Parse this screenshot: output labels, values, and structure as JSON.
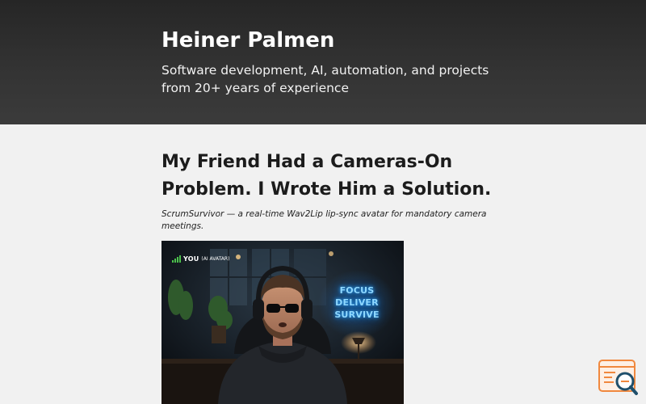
{
  "header": {
    "site_title": "Heiner Palmen",
    "tagline": "Software development, AI, automation, and projects from 20+ years of experience"
  },
  "post": {
    "title": "My Friend Had a Cameras-On Problem. I Wrote Him a Solution.",
    "subtitle": "ScrumSurvivor — a real-time Wav2Lip lip-sync avatar for mandatory camera meetings."
  },
  "hero_image": {
    "badge_label": "YOU",
    "badge_sub": "(AI AVATAR)",
    "neon_lines": [
      "FOCUS",
      "DELIVER",
      "SURVIVE"
    ],
    "icons": [
      "signal-bars-icon"
    ]
  },
  "floating_widget": {
    "icon": "search-document-icon",
    "accent_color": "#f0883e"
  },
  "colors": {
    "header_bg": "#2f2f2f",
    "page_bg": "#f1f1f1",
    "neon": "#2aa6ff",
    "signal": "#4cc24c"
  }
}
